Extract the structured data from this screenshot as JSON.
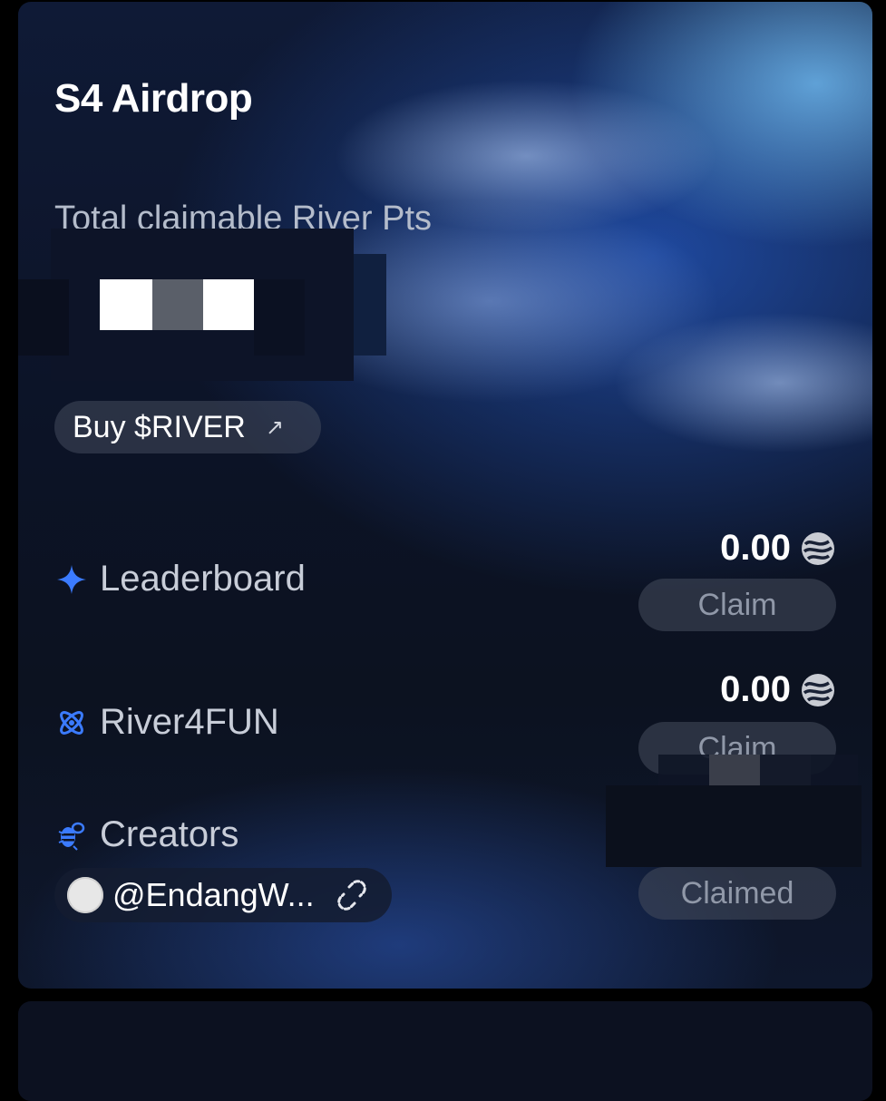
{
  "card": {
    "title": "S4 Airdrop",
    "total_label": "Total claimable River Pts",
    "buy_button": {
      "label": "Buy $RIVER",
      "icon": "arrow-up-right-icon"
    }
  },
  "rows": [
    {
      "label": "Leaderboard",
      "icon": "sparkle-icon",
      "amount": "0.00",
      "coin_icon": "river-coin-icon",
      "button": "Claim"
    },
    {
      "label": "River4FUN",
      "icon": "atom-icon",
      "amount": "0.00",
      "coin_icon": "river-coin-icon",
      "button": "Claim"
    },
    {
      "label": "Creators",
      "icon": "bee-icon",
      "button": "Claimed"
    }
  ],
  "creator": {
    "handle": "@EndangW...",
    "link_icon": "unlink-icon"
  },
  "colors": {
    "accent_blue": "#3b7bff",
    "card_bg": "#0c1326",
    "muted_text": "#b4bccb"
  }
}
